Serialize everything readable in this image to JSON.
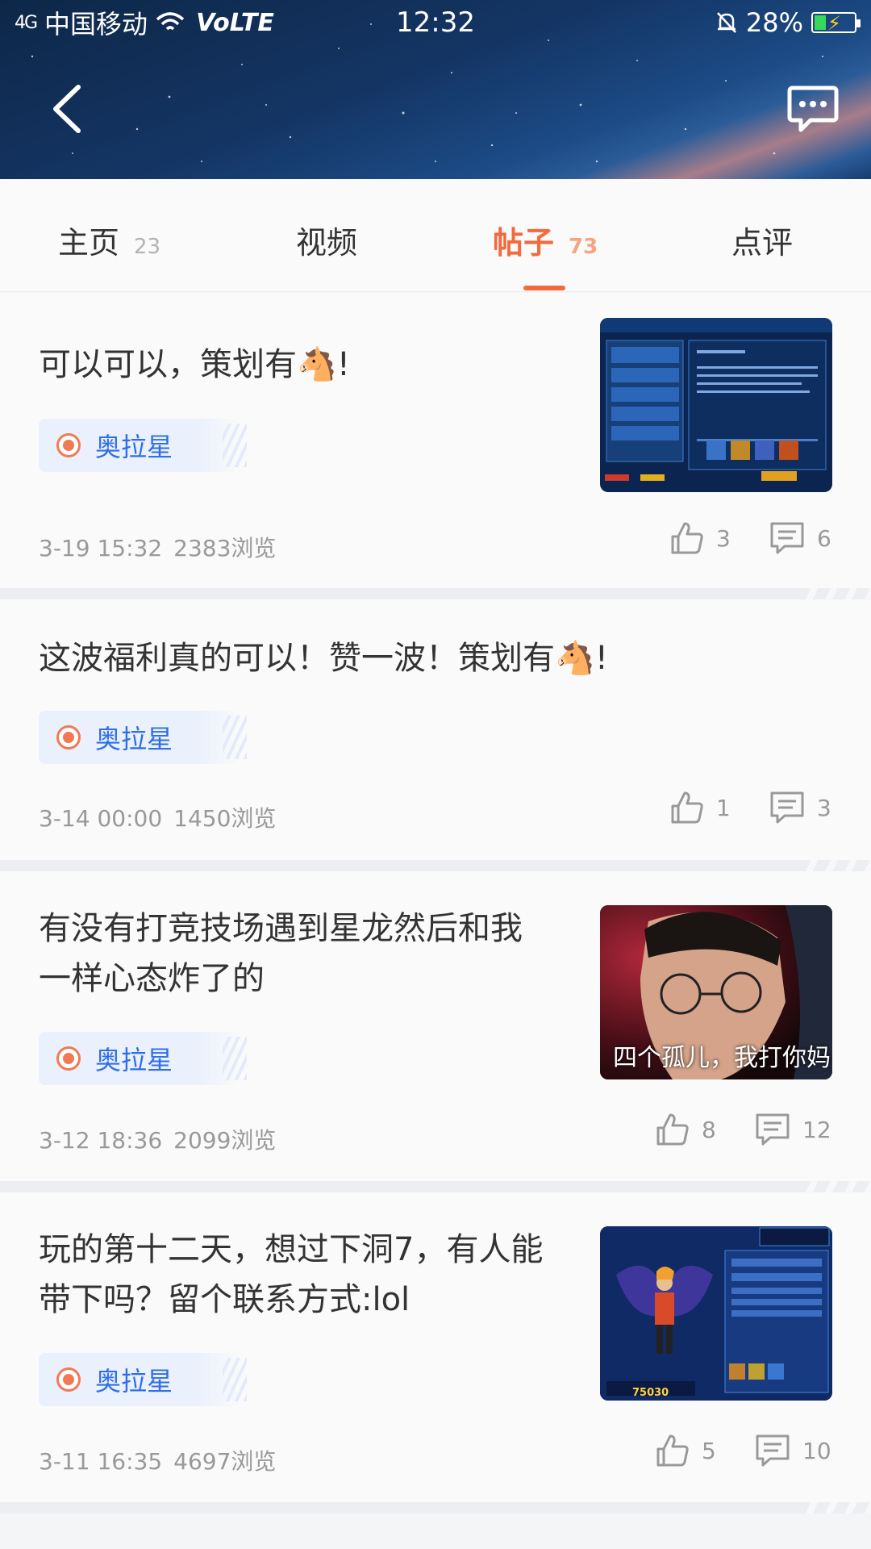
{
  "status_bar": {
    "signal": "4G",
    "carrier": "中国移动",
    "volte": "VoLTE",
    "time": "12:32",
    "battery": "28%"
  },
  "tabs": [
    {
      "label": "主页",
      "count": "23"
    },
    {
      "label": "视频",
      "count": ""
    },
    {
      "label": "帖子",
      "count": "73"
    },
    {
      "label": "点评",
      "count": ""
    }
  ],
  "posts": [
    {
      "title": "可以可以，策划有",
      "title_suffix": "!",
      "emoji": "🐴",
      "tag": "奥拉星",
      "date": "3-19 15:32",
      "views": "2383浏览",
      "likes": "3",
      "comments": "6",
      "thumb": "game-screenshot-event"
    },
    {
      "title": "这波福利真的可以！赞一波！策划有",
      "title_suffix": "!",
      "emoji": "🐴",
      "tag": "奥拉星",
      "date": "3-14 00:00",
      "views": "1450浏览",
      "likes": "1",
      "comments": "3"
    },
    {
      "title_line1": "有没有打竞技场遇到星龙然后和我",
      "title_line2": "一样心态炸了的",
      "tag": "奥拉星",
      "date": "3-12 18:36",
      "views": "2099浏览",
      "likes": "8",
      "comments": "12",
      "thumb_caption": "四个孤儿，我打你妈"
    },
    {
      "title_line1": "玩的第十二天，想过下洞7，有人能",
      "title_line2": "带下吗？留个联系方式:lol",
      "tag": "奥拉星",
      "date": "3-11 16:35",
      "views": "4697浏览",
      "likes": "5",
      "comments": "10",
      "thumb_power": "75030"
    }
  ],
  "colors": {
    "accent": "#f26a3d",
    "tag_text": "#2f6ee8",
    "tag_bg": "#eaf0fc"
  }
}
